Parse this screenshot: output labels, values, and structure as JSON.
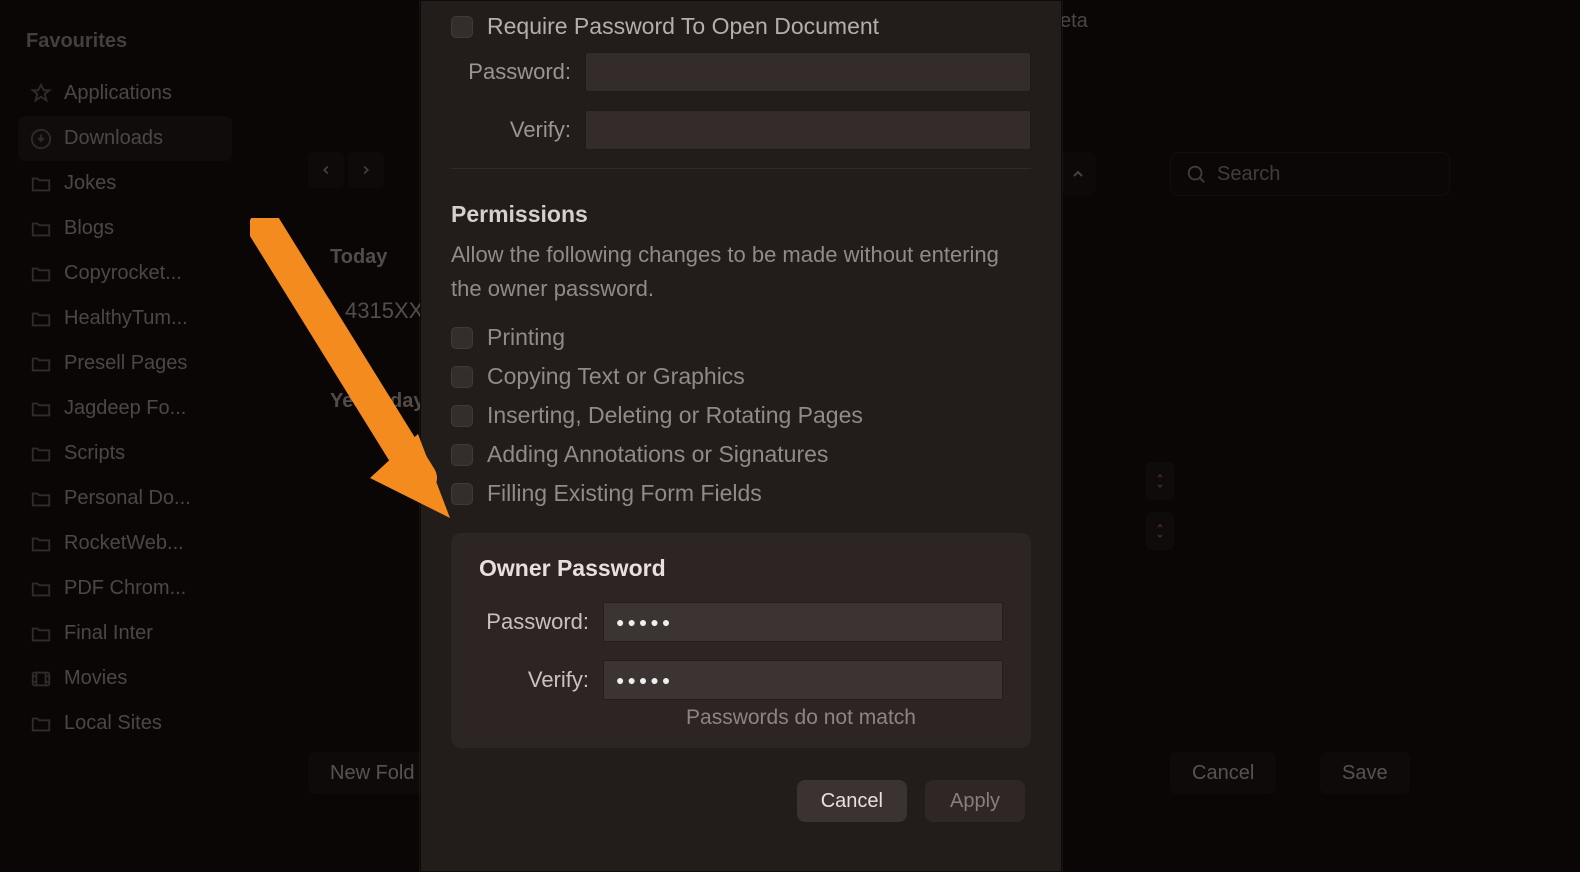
{
  "sidebar": {
    "header": "Favourites",
    "items": [
      {
        "label": "Applications",
        "icon": "apps"
      },
      {
        "label": "Downloads",
        "icon": "downloads",
        "selected": true
      },
      {
        "label": "Jokes",
        "icon": "folder"
      },
      {
        "label": "Blogs",
        "icon": "folder"
      },
      {
        "label": "Copyrocket...",
        "icon": "folder"
      },
      {
        "label": "HealthyTum...",
        "icon": "folder"
      },
      {
        "label": "Presell Pages",
        "icon": "folder"
      },
      {
        "label": "Jagdeep Fo...",
        "icon": "folder"
      },
      {
        "label": "Scripts",
        "icon": "folder"
      },
      {
        "label": "Personal Do...",
        "icon": "folder"
      },
      {
        "label": "RocketWeb...",
        "icon": "folder"
      },
      {
        "label": "PDF Chrom...",
        "icon": "folder"
      },
      {
        "label": "Final Inter",
        "icon": "folder"
      },
      {
        "label": "Movies",
        "icon": "movies"
      },
      {
        "label": "Local Sites",
        "icon": "folder"
      }
    ]
  },
  "main": {
    "date_groups": [
      {
        "label": "Today",
        "file": "4315XX"
      },
      {
        "label": "Yesterday",
        "file": ""
      }
    ],
    "deta_label": "eta",
    "search_placeholder": "Search",
    "new_folder": "New Fold",
    "cancel": "Cancel",
    "save": "Save"
  },
  "dialog": {
    "require_label": "Require Password To Open Document",
    "password_label": "Password:",
    "verify_label": "Verify:",
    "permissions_title": "Permissions",
    "permissions_desc": "Allow the following changes to be made without entering the owner password.",
    "perms": [
      "Printing",
      "Copying Text or Graphics",
      "Inserting, Deleting or Rotating Pages",
      "Adding Annotations or Signatures",
      "Filling Existing Form Fields"
    ],
    "owner_title": "Owner Password",
    "owner_password_label": "Password:",
    "owner_verify_label": "Verify:",
    "owner_password_value": "●●●●●",
    "owner_verify_value": "●●●●●",
    "error": "Passwords do not match",
    "cancel": "Cancel",
    "apply": "Apply"
  }
}
